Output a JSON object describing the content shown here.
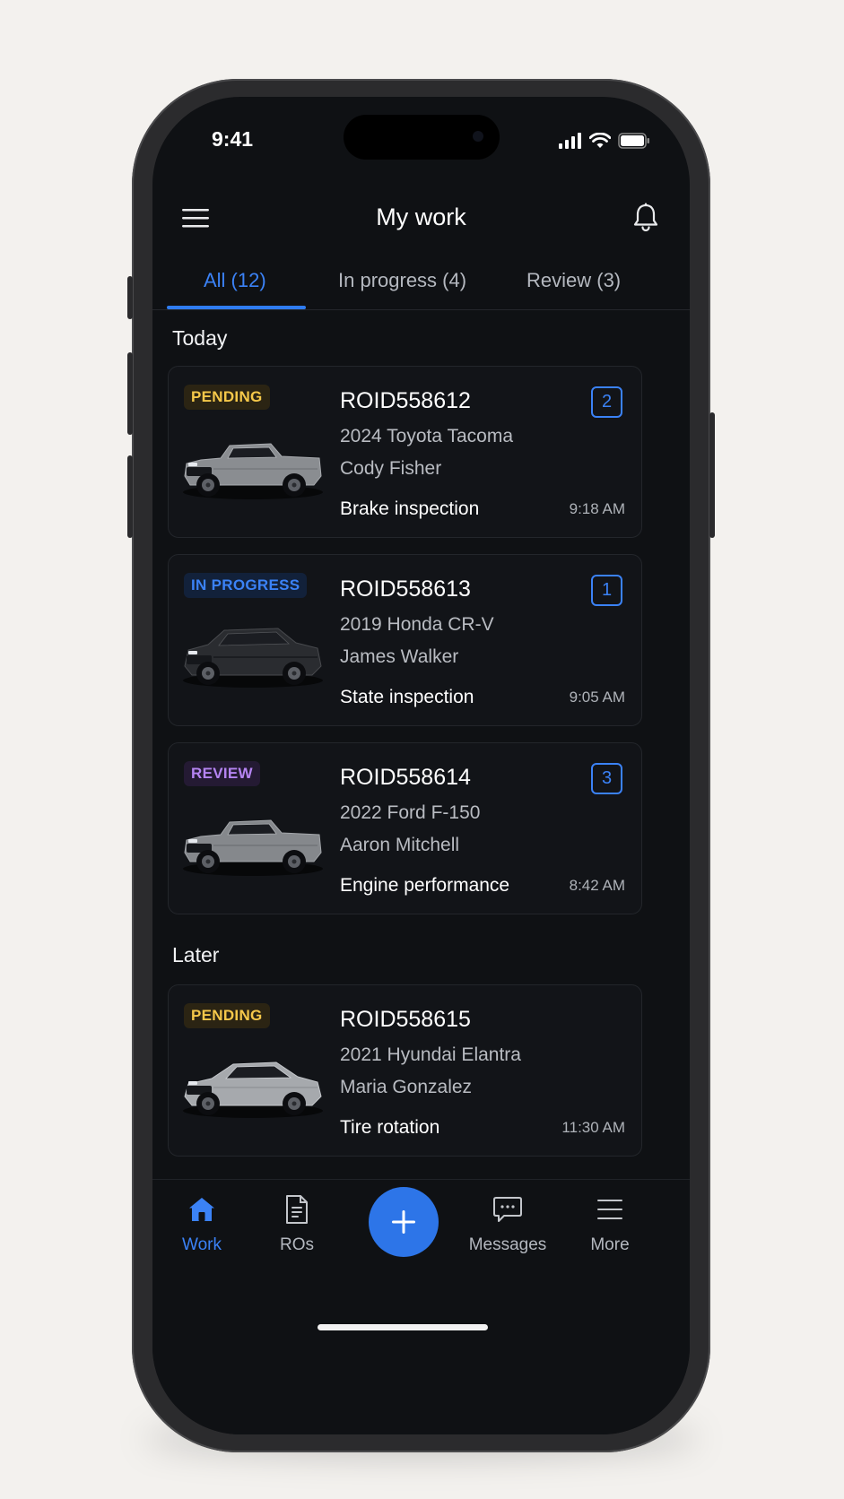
{
  "status_bar": {
    "time": "9:41"
  },
  "header": {
    "title": "My work"
  },
  "tabs": [
    {
      "label": "All (12)",
      "active": true
    },
    {
      "label": "In progress (4)",
      "active": false
    },
    {
      "label": "Review (3)",
      "active": false
    }
  ],
  "sections": {
    "today": "Today",
    "later": "Later"
  },
  "cards": [
    {
      "status": "PENDING",
      "ro": "ROID558612",
      "vehicle": "2024 Toyota Tacoma",
      "customer": "Cody Fisher",
      "service": "Brake inspection",
      "time": "9:18 AM",
      "count": "2",
      "car_color": "#8a8d91",
      "car_type": "pickup"
    },
    {
      "status": "IN PROGRESS",
      "ro": "ROID558613",
      "vehicle": "2019 Honda CR-V",
      "customer": "James Walker",
      "service": "State inspection",
      "time": "9:05 AM",
      "count": "1",
      "car_color": "#2a2c30",
      "car_type": "suv"
    },
    {
      "status": "REVIEW",
      "ro": "ROID558614",
      "vehicle": "2022 Ford F-150",
      "customer": "Aaron Mitchell",
      "service": "Engine performance",
      "time": "8:42 AM",
      "count": "3",
      "car_color": "#85888c",
      "car_type": "pickup"
    },
    {
      "status": "PENDING",
      "ro": "ROID558615",
      "vehicle": "2021 Hyundai Elantra",
      "customer": "Maria Gonzalez",
      "service": "Tire rotation",
      "time": "11:30 AM",
      "count": "",
      "car_color": "#a6a9ad",
      "car_type": "sedan"
    }
  ],
  "bottom_nav": {
    "work": "Work",
    "ros": "ROs",
    "messages": "Messages",
    "more": "More"
  },
  "colors": {
    "accent": "#3b82f6",
    "pending": "#f5c84a",
    "review": "#b584f2"
  },
  "icons": {
    "menu": "hamburger-icon",
    "bell": "bell-icon",
    "add": "plus-icon"
  }
}
